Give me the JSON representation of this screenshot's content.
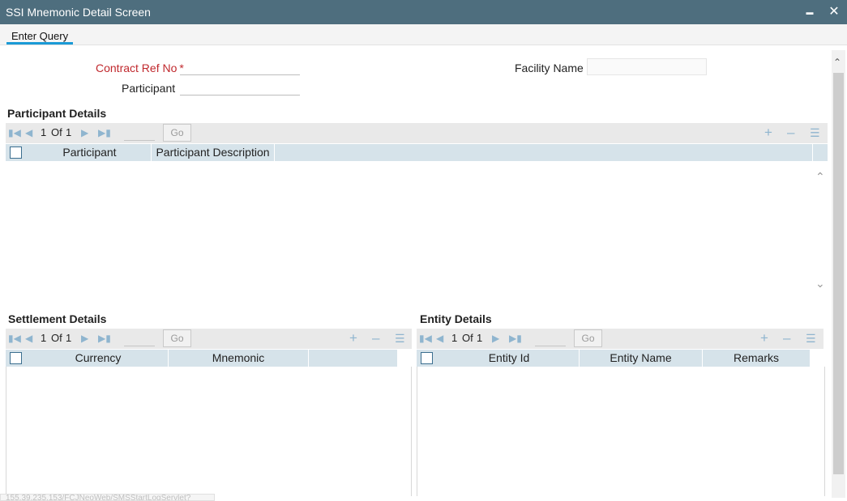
{
  "window": {
    "title": "SSI Mnemonic Detail Screen",
    "minimize_glyph": "▬",
    "close_glyph": "✕"
  },
  "toolbar": {
    "enter_query_label": "Enter Query"
  },
  "form": {
    "contract_ref_label": "Contract Ref No",
    "required_marker": "*",
    "contract_ref_value": "",
    "participant_label": "Participant",
    "participant_value": "",
    "facility_name_label": "Facility Name",
    "facility_name_value": ""
  },
  "participant_details": {
    "title": "Participant Details",
    "pager": {
      "current": "1",
      "of_label": "Of",
      "total": "1",
      "go_label": "Go"
    },
    "columns": [
      "Participant",
      "Participant Description"
    ]
  },
  "settlement_details": {
    "title": "Settlement Details",
    "pager": {
      "current": "1",
      "of_label": "Of",
      "total": "1",
      "go_label": "Go"
    },
    "columns": [
      "Currency",
      "Mnemonic"
    ]
  },
  "entity_details": {
    "title": "Entity Details",
    "pager": {
      "current": "1",
      "of_label": "Of",
      "total": "1",
      "go_label": "Go"
    },
    "columns": [
      "Entity Id",
      "Entity Name",
      "Remarks"
    ]
  },
  "status_bar": {
    "text": "155.39.235.153/FCJNeoWeb/SMSStartLogServlet?"
  },
  "colors": {
    "title_bar": "#4e6e7e",
    "required_label": "#c0282d",
    "tab_underline": "#1a9ad6",
    "grid_header": "#d6e3ea",
    "pager_bg": "#e9e9e9"
  },
  "icons": {
    "first": "first-page-icon",
    "prev": "previous-page-icon",
    "next": "next-page-icon",
    "last": "last-page-icon",
    "add": "add-row-icon",
    "remove": "delete-row-icon",
    "single_view": "single-view-icon"
  }
}
